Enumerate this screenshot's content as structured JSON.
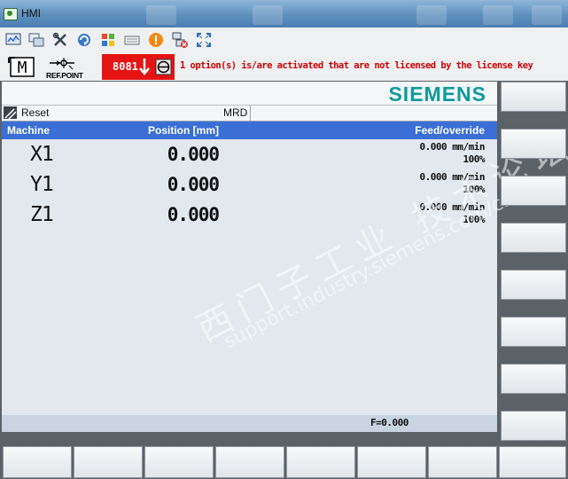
{
  "window": {
    "title": "HMI"
  },
  "toolbar": {
    "icons": [
      "monitor-icon",
      "copy-windows-icon",
      "tools-icon",
      "refresh-icon",
      "windows-logo-icon",
      "keyboard-icon",
      "warning-icon",
      "network-icon",
      "fullscreen-icon"
    ]
  },
  "status": {
    "mode_symbol": "M",
    "refpoint_label": "REF.POINT",
    "alarm_code": "8081",
    "alarm_message": "1 option(s) is/are activated that are not licensed by the license key",
    "alarm_color": "#e61313",
    "alarm_text_color": "#d10000"
  },
  "brand": {
    "name": "SIEMENS",
    "color": "#0e9b9b"
  },
  "channel": {
    "state": "Reset",
    "program": "MRD"
  },
  "table": {
    "headers": {
      "machine": "Machine",
      "position": "Position [mm]",
      "feed": "Feed/override"
    },
    "header_color": "#3b6fd6",
    "axes": [
      {
        "name": "X1",
        "position": "0.000",
        "feed": "0.000 mm/min",
        "override": "100%"
      },
      {
        "name": "Y1",
        "position": "0.000",
        "feed": "0.000 mm/min",
        "override": "100%"
      },
      {
        "name": "Z1",
        "position": "0.000",
        "feed": "0.000 mm/min",
        "override": "100%"
      }
    ]
  },
  "watermark": {
    "line1": "西门子工业 技术论坛",
    "line2": "support.industry.siemens.com/cs"
  },
  "feedrate": {
    "label": "F=0.000"
  }
}
